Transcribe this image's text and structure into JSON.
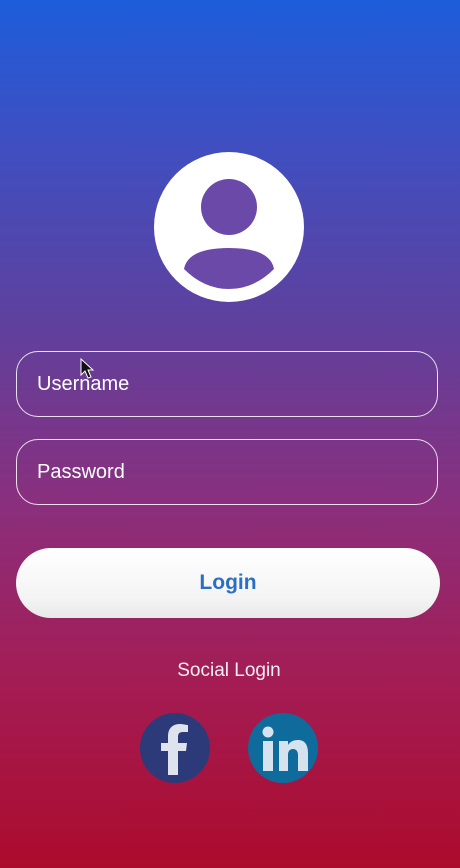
{
  "avatar": {
    "icon": "user-profile-icon"
  },
  "form": {
    "username_placeholder": "Username",
    "password_placeholder": "Password",
    "login_label": "Login"
  },
  "social": {
    "label": "Social Login",
    "buttons": [
      {
        "name": "Facebook",
        "icon": "facebook-icon",
        "color": "#2c3a7a"
      },
      {
        "name": "LinkedIn",
        "icon": "linkedin-icon",
        "color": "#0e6b9c"
      }
    ]
  },
  "colors": {
    "gradient_top": "#1d5ddb",
    "gradient_bottom": "#ac0b2c",
    "button_text": "#2b6fc4"
  }
}
